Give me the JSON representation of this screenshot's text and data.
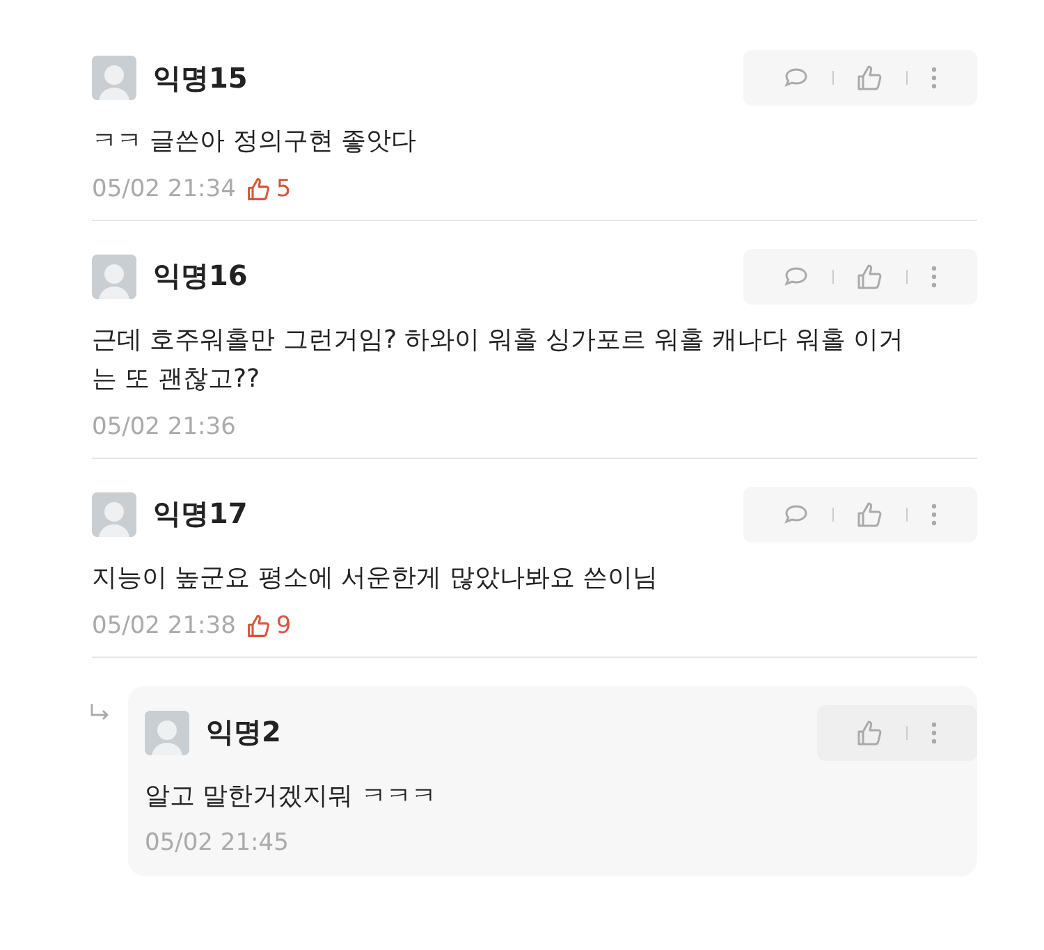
{
  "comments": [
    {
      "kind": "comment",
      "author": "익명15",
      "body": "ㅋㅋ 글쓴아 정의구현 좋앗다",
      "time": "05/02 21:34",
      "likes": "5"
    },
    {
      "kind": "comment",
      "author": "익명16",
      "body": "근데 호주워홀만 그런거임? 하와이 워홀 싱가포르 워홀 캐나다 워홀 이거는 또 괜찮고??",
      "time": "05/02 21:36"
    },
    {
      "kind": "comment",
      "author": "익명17",
      "body": "지능이 높군요 평소에 서운한게 많았나봐요 쓴이님",
      "time": "05/02 21:38",
      "likes": "9"
    },
    {
      "kind": "reply",
      "author": "익명2",
      "body": "알고 말한거겠지뭐 ㅋㅋㅋ",
      "time": "05/02 21:45"
    }
  ]
}
